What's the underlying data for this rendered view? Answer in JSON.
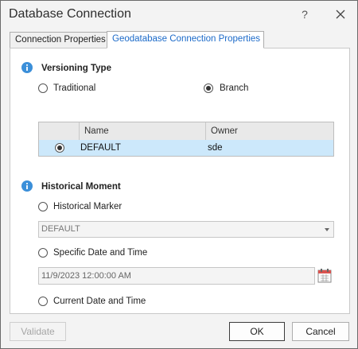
{
  "window": {
    "title": "Database Connection",
    "help_label": "?"
  },
  "tabs": [
    {
      "label": "Connection Properties"
    },
    {
      "label": "Geodatabase Connection Properties"
    }
  ],
  "versioning": {
    "title": "Versioning Type",
    "options": [
      {
        "label": "Traditional",
        "selected": false
      },
      {
        "label": "Branch",
        "selected": true
      }
    ],
    "grid": {
      "columns": [
        "Name",
        "Owner"
      ],
      "rows": [
        {
          "name": "DEFAULT",
          "owner": "sde",
          "selected": true
        }
      ]
    }
  },
  "historical": {
    "title": "Historical Moment",
    "marker_label": "Historical Marker",
    "marker_value": "DEFAULT",
    "specific_label": "Specific Date and Time",
    "date_value": "11/9/2023 12:00:00 AM",
    "current_label": "Current Date and Time"
  },
  "footer": {
    "validate_label": "Validate",
    "ok_label": "OK",
    "cancel_label": "Cancel"
  },
  "colors": {
    "accent": "#1b6ac9",
    "info_icon": "#3b8fd9",
    "selection": "#cce8fb"
  }
}
